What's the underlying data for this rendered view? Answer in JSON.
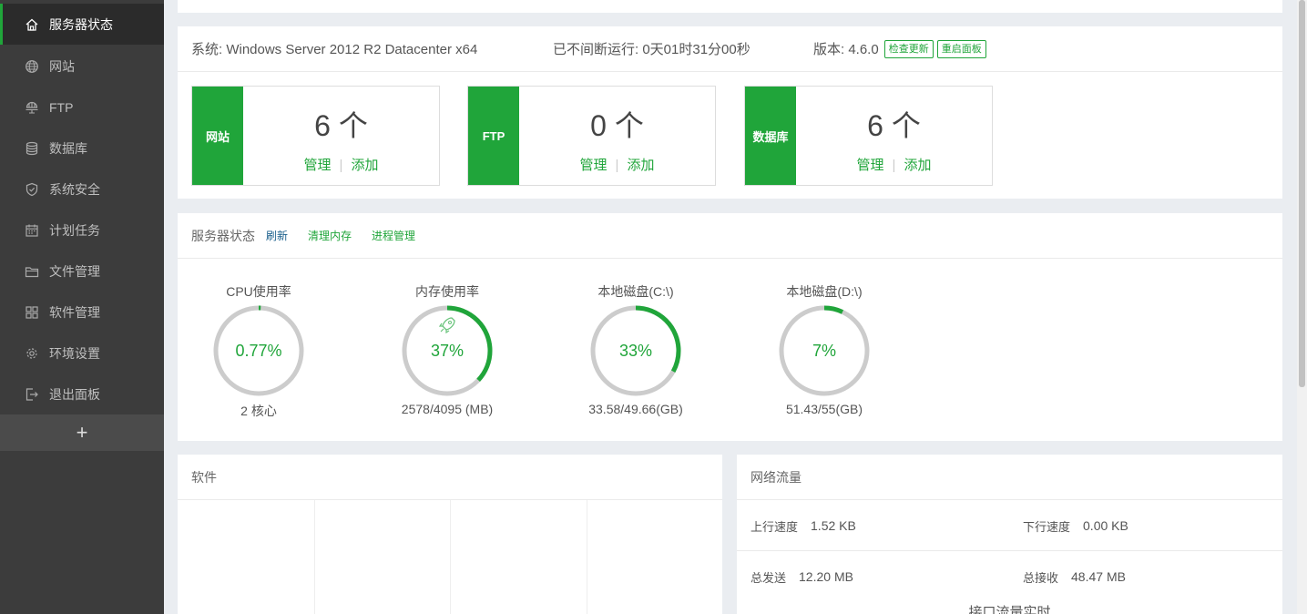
{
  "sidebar": {
    "items": [
      {
        "label": "服务器状态",
        "icon": "home-icon"
      },
      {
        "label": "网站",
        "icon": "globe-icon"
      },
      {
        "label": "FTP",
        "icon": "ftp-icon"
      },
      {
        "label": "数据库",
        "icon": "database-icon"
      },
      {
        "label": "系统安全",
        "icon": "shield-icon"
      },
      {
        "label": "计划任务",
        "icon": "calendar-icon"
      },
      {
        "label": "文件管理",
        "icon": "folder-icon"
      },
      {
        "label": "软件管理",
        "icon": "grid-icon"
      },
      {
        "label": "环境设置",
        "icon": "gear-icon"
      },
      {
        "label": "退出面板",
        "icon": "logout-icon"
      }
    ],
    "add_label": "+"
  },
  "sysinfo": {
    "os": "系统: Windows Server 2012 R2 Datacenter x64",
    "uptime": "已不间断运行: 0天01时31分00秒",
    "version": "版本: 4.6.0",
    "check_update": "检查更新",
    "restart_panel": "重启面板"
  },
  "counts": [
    {
      "tag": "网站",
      "count": "6 个",
      "manage": "管理",
      "sep": "|",
      "add": "添加"
    },
    {
      "tag": "FTP",
      "count": "0 个",
      "manage": "管理",
      "sep": "|",
      "add": "添加"
    },
    {
      "tag": "数据库",
      "count": "6 个",
      "manage": "管理",
      "sep": "|",
      "add": "添加"
    }
  ],
  "status": {
    "title": "服务器状态",
    "refresh": "刷新",
    "clear_memory": "清理内存",
    "process_manage": "进程管理",
    "gauges": [
      {
        "title": "CPU使用率",
        "value": "0.77%",
        "percent": 0.77,
        "foot": "2 核心",
        "rocket": false
      },
      {
        "title": "内存使用率",
        "value": "37%",
        "percent": 37,
        "foot": "2578/4095 (MB)",
        "rocket": true
      },
      {
        "title": "本地磁盘(C:\\)",
        "value": "33%",
        "percent": 33,
        "foot": "33.58/49.66(GB)",
        "rocket": false
      },
      {
        "title": "本地磁盘(D:\\)",
        "value": "7%",
        "percent": 7,
        "foot": "51.43/55(GB)",
        "rocket": false
      }
    ]
  },
  "software": {
    "title": "软件"
  },
  "traffic": {
    "title": "网络流量",
    "up_label": "上行速度",
    "up_value": "1.52 KB",
    "down_label": "下行速度",
    "down_value": "0.00 KB",
    "sent_label": "总发送",
    "sent_value": "12.20 MB",
    "recv_label": "总接收",
    "recv_value": "48.47 MB",
    "footer": "接口流量实时"
  },
  "colors": {
    "accent": "#20a53a",
    "sidebar_bg": "#3c3c3c",
    "ring_bg": "#cccccc"
  }
}
